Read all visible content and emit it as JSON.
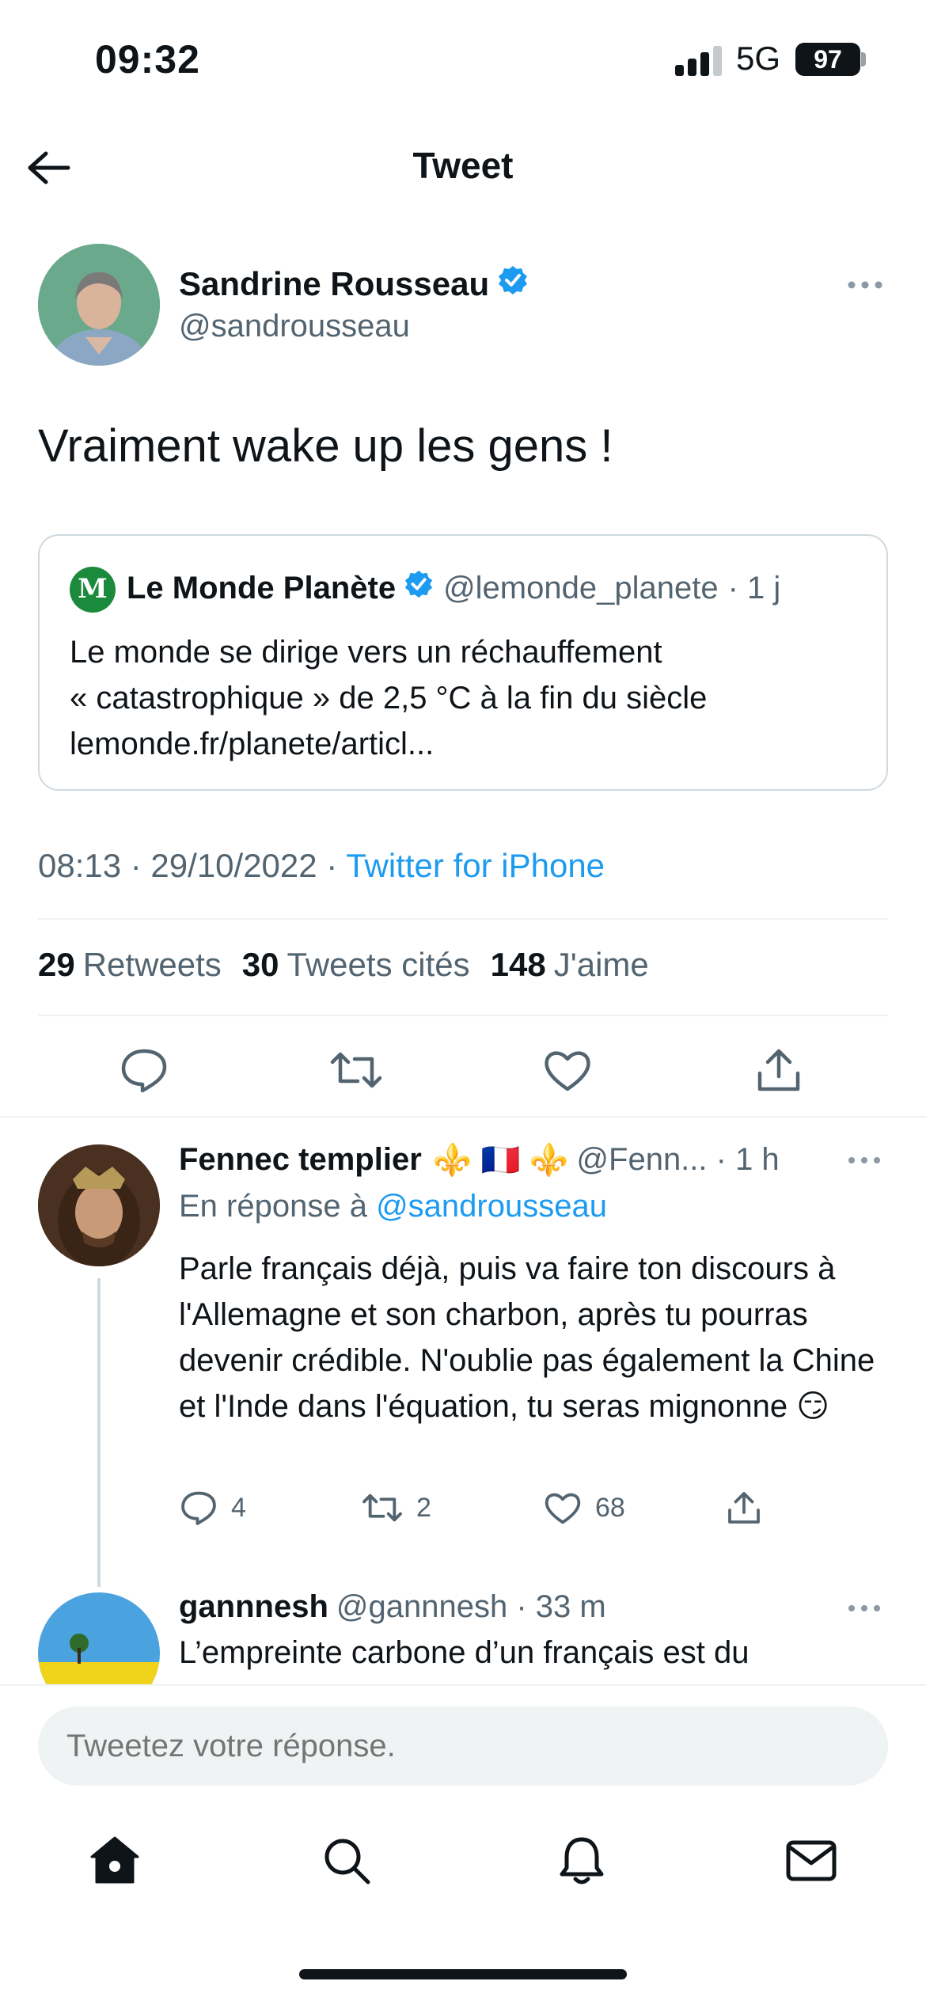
{
  "status_bar": {
    "time": "09:32",
    "network": "5G",
    "battery": "97"
  },
  "header": {
    "title": "Tweet"
  },
  "tweet": {
    "author_name": "Sandrine Rousseau",
    "author_handle": "@sandrousseau",
    "text": "Vraiment wake up les gens !",
    "quote": {
      "logo_letter": "M",
      "name": "Le Monde Planète",
      "handle": "@lemonde_planete",
      "time": "· 1 j",
      "line1": "Le monde se dirige vers un réchauffement",
      "line2": "« catastrophique » de 2,5 °C à la fin du siècle",
      "line3": "lemonde.fr/planete/articl..."
    },
    "timestamp": "08:13 · 29/10/2022 ·",
    "source": "Twitter for iPhone",
    "stats": {
      "retweets_count": "29",
      "retweets_label": "Retweets",
      "quotes_count": "30",
      "quotes_label": "Tweets cités",
      "likes_count": "148",
      "likes_label": "J'aime"
    }
  },
  "replies": [
    {
      "name": "Fennec templier",
      "emoji": "⚜️ 🇫🇷 ⚜️",
      "handle": "@Fenn... · 1 h",
      "in_reply_prefix": "En réponse à",
      "in_reply_handle": "@sandrousseau",
      "text": "Parle français déjà, puis va faire ton discours à l'Allemagne et son charbon, après tu pourras devenir crédible. N'oublie pas également la Chine et l'Inde dans l'équation, tu seras mignonne 😏",
      "reply_count": "4",
      "retweet_count": "2",
      "like_count": "68"
    },
    {
      "name": "gannnesh",
      "handle": "@gannnesh · 33 m",
      "text": "L’empreinte carbone d’un français est du"
    }
  ],
  "compose": {
    "placeholder": "Tweetez votre réponse."
  },
  "colors": {
    "accent": "#1d9bf0",
    "secondary_text": "#536471",
    "primary_text": "#0f1419"
  }
}
